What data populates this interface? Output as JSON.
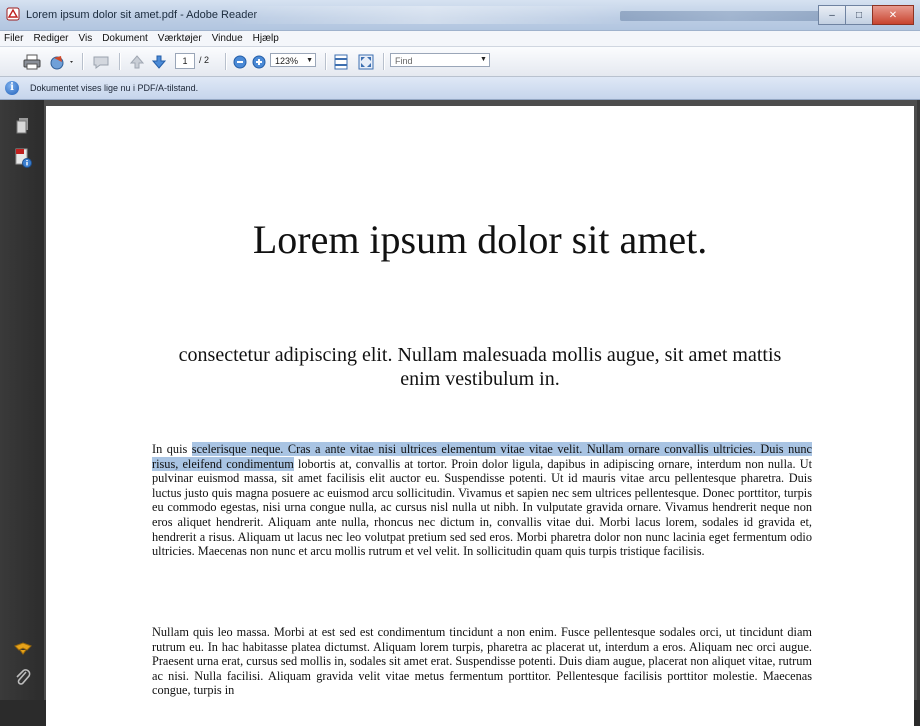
{
  "window": {
    "title": "Lorem ipsum dolor sit amet.pdf - Adobe Reader",
    "controls": {
      "minimize": "–",
      "maximize": "□",
      "close": "✕"
    }
  },
  "menu": [
    "Filer",
    "Rediger",
    "Vis",
    "Dokument",
    "Værktøjer",
    "Vindue",
    "Hjælp"
  ],
  "toolbar": {
    "current_page": "1",
    "total_pages": "/ 2",
    "zoom": "123%",
    "find_placeholder": "Find"
  },
  "infobar": {
    "message": "Dokumentet vises lige nu i PDF/A-tilstand."
  },
  "document": {
    "title": "Lorem ipsum dolor sit amet.",
    "subtitle": "consectetur adipiscing elit. Nullam malesuada mollis augue, sit amet mattis enim vestibulum in.",
    "paragraph1": {
      "before": "In quis ",
      "selected": "scelerisque neque. Cras a ante vitae nisi ultrices elementum vitae vitae velit. Nullam ornare convallis ultricies. Duis nunc risus, eleifend condimentum",
      "after": " lobortis at, convallis at tortor. Proin dolor ligula, dapibus in adipiscing ornare, interdum non nulla. Ut pulvinar euismod massa, sit amet facilisis elit auctor eu. Suspendisse potenti. Ut id mauris vitae arcu pellentesque pharetra. Duis luctus justo quis magna posuere ac euismod arcu sollicitudin. Vivamus et sapien nec sem ultrices pellentesque. Donec porttitor, turpis eu commodo egestas, nisi urna congue nulla, ac cursus nisl nulla ut nibh. In vulputate gravida ornare. Vivamus hendrerit neque non eros aliquet hendrerit. Aliquam ante nulla, rhoncus nec dictum in, convallis vitae dui. Morbi lacus lorem, sodales id gravida et, hendrerit a risus. Aliquam ut lacus nec leo volutpat pretium sed sed eros. Morbi pharetra dolor non nunc lacinia eget fermentum odio ultricies. Maecenas non nunc et arcu mollis rutrum et vel velit. In sollicitudin quam quis turpis tristique facilisis."
    },
    "paragraph2": "Nullam quis leo massa. Morbi at est sed est condimentum tincidunt a non enim. Fusce pellentesque sodales orci, ut tincidunt diam rutrum eu. In hac habitasse platea dictumst. Aliquam lorem turpis, pharetra ac placerat ut, interdum a eros. Aliquam nec orci augue. Praesent urna erat, cursus sed mollis in, sodales sit amet erat. Suspendisse potenti. Duis diam augue, placerat non aliquet vitae, rutrum ac nisi. Nulla facilisi. Aliquam gravida velit vitae metus fermentum porttitor. Pellentesque facilisis porttitor molestie. Maecenas congue, turpis in"
  },
  "icons": {
    "toolbar": [
      "print-icon",
      "share-icon",
      "comment-icon",
      "previous-page-icon",
      "next-page-icon",
      "zoom-out-icon",
      "zoom-in-icon",
      "fit-page-icon",
      "full-screen-icon"
    ],
    "rail": [
      "pages-icon",
      "attachments-pdf-icon",
      "sign-icon",
      "paperclip-icon"
    ]
  },
  "colors": {
    "selection": "#a9c4e3",
    "infobar": "#c6d5ec"
  }
}
